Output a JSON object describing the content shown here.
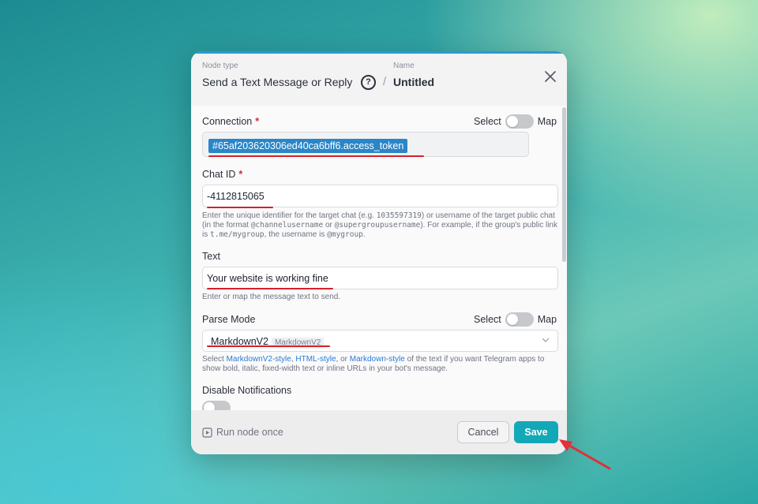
{
  "header": {
    "node_type_label": "Node type",
    "node_type_value": "Send a Text Message or Reply",
    "name_label": "Name",
    "name_value": "Untitled",
    "separator": "/"
  },
  "connection": {
    "label": "Connection",
    "required_mark": "*",
    "toggle_left": "Select",
    "toggle_right": "Map",
    "value": "#65af203620306ed40ca6bff6.access_token"
  },
  "chat_id": {
    "label": "Chat ID",
    "required_mark": "*",
    "value": "-4112815065",
    "help_1": "Enter the unique identifier for the target chat (e.g. ",
    "help_code_1": "1035597319",
    "help_2": ") or username of the target public chat (in the format ",
    "help_code_2": "@channelusername",
    "help_3": " or ",
    "help_code_3": "@supergroupusername",
    "help_4": "). For example, if the group's public link is ",
    "help_code_4": "t.me/mygroup",
    "help_5": ", the username is ",
    "help_code_5": "@mygroup",
    "help_6": "."
  },
  "text": {
    "label": "Text",
    "value": "Your website is working fine",
    "help": "Enter or map the message text to send."
  },
  "parse_mode": {
    "label": "Parse Mode",
    "toggle_left": "Select",
    "toggle_right": "Map",
    "selected": "MarkdownV2",
    "selected_tag": "MarkdownV2",
    "help_1": "Select ",
    "link_1": "MarkdownV2-style",
    "help_2": ", ",
    "link_2": "HTML-style",
    "help_3": ", or ",
    "link_3": "Markdown-style",
    "help_4": " of the text if you want Telegram apps to show bold, italic, fixed-width text or inline URLs in your bot's message."
  },
  "disable_notifications": {
    "label": "Disable Notifications"
  },
  "footer": {
    "run_label": "Run node once",
    "cancel_label": "Cancel",
    "save_label": "Save"
  },
  "colors": {
    "accent": "#12a8b8",
    "connection_button": "#8a1fb8",
    "token_highlight": "#2a86c8",
    "annotation_red": "#d7202b"
  }
}
